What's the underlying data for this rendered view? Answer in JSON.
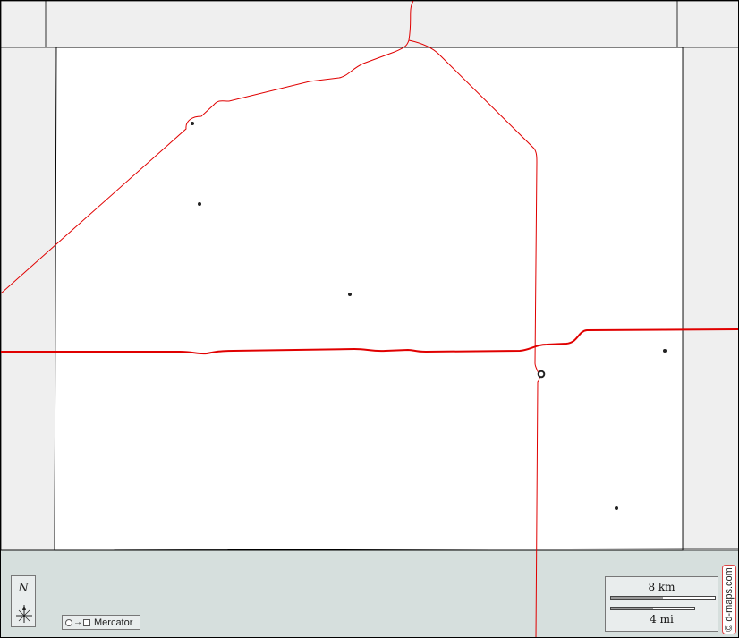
{
  "map": {
    "colors": {
      "water": "#d6dfdd",
      "outside_land": "#efefef",
      "county": "#ffffff",
      "border": "#000000",
      "road": "#e00000",
      "frame_bg": "#e9eded"
    },
    "compass": {
      "letter": "N",
      "icon": "compass-rose-icon"
    },
    "projection": {
      "label": "Mercator"
    },
    "scale_bar": {
      "km_label": "8 km",
      "mi_label": "4 mi"
    },
    "credit": {
      "text": "© d-maps.com"
    },
    "places": [
      {
        "type": "town"
      },
      {
        "type": "town"
      },
      {
        "type": "town"
      },
      {
        "type": "town"
      },
      {
        "type": "town"
      },
      {
        "type": "capital"
      }
    ]
  }
}
